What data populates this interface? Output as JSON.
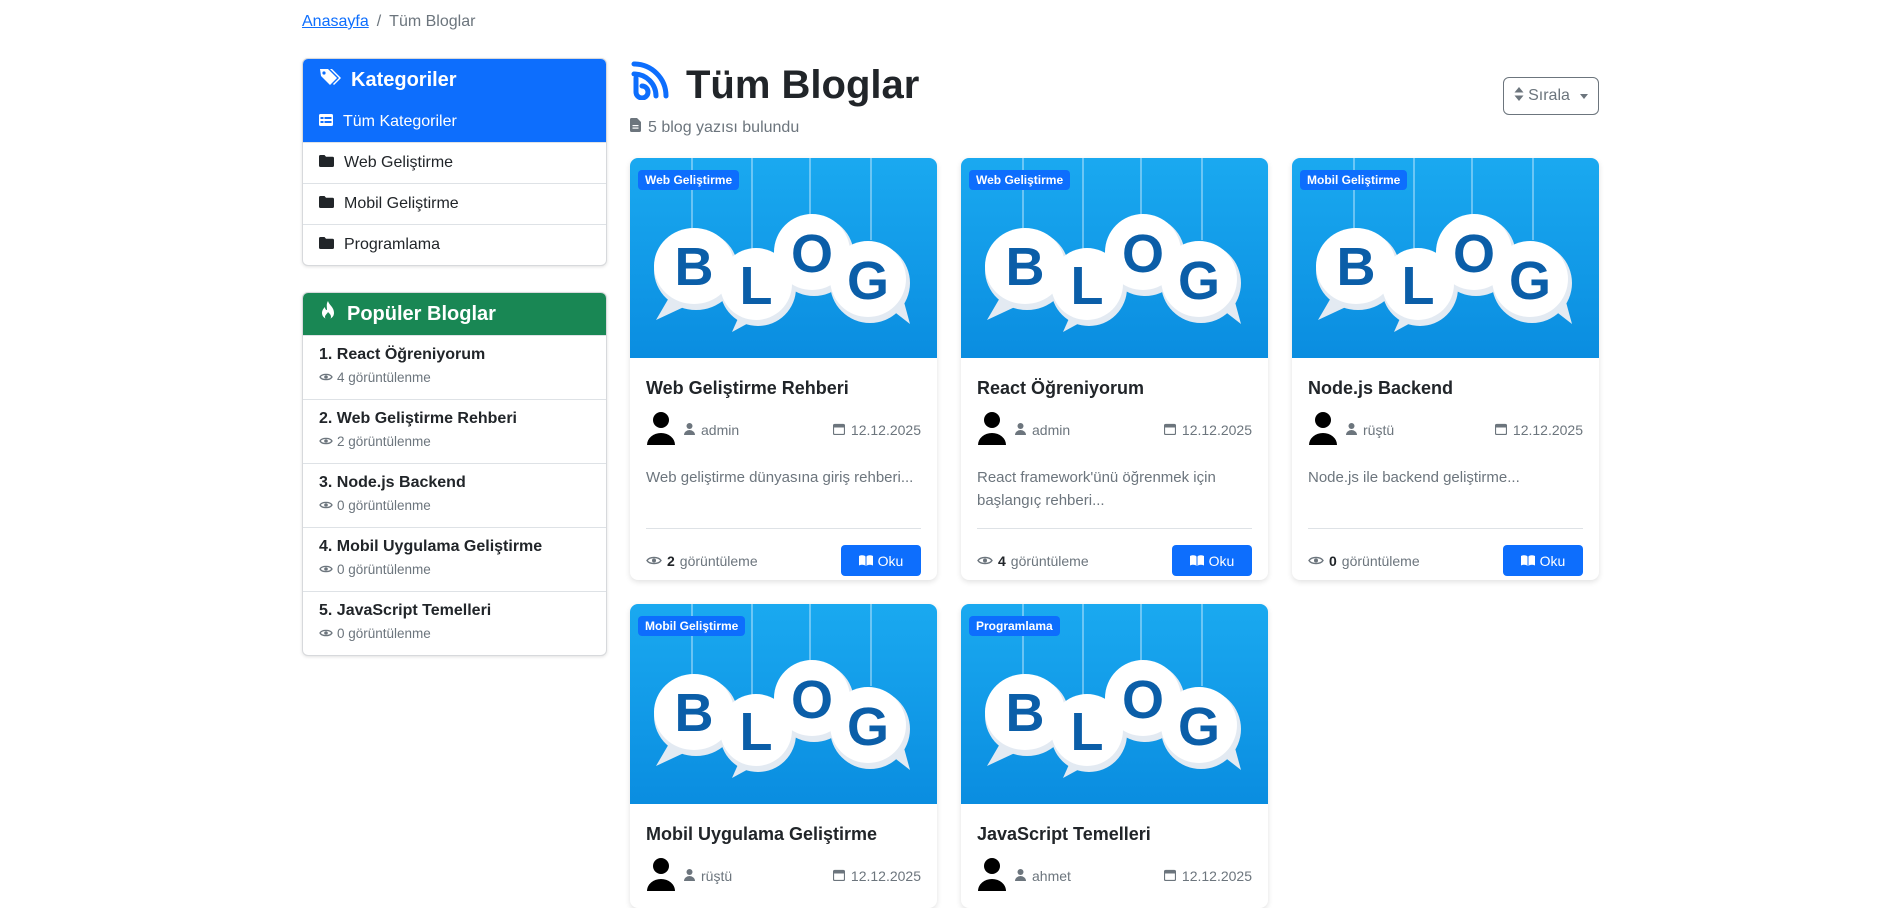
{
  "breadcrumb": {
    "home": "Anasayfa",
    "sep": "/",
    "current": "Tüm Bloglar"
  },
  "sidebar": {
    "categories_title": "Kategoriler",
    "categories": [
      {
        "label": "Tüm Kategoriler",
        "active": true
      },
      {
        "label": "Web Geliştirme"
      },
      {
        "label": "Mobil Geliştirme"
      },
      {
        "label": "Programlama"
      }
    ],
    "popular_title": "Popüler Bloglar",
    "popular": [
      {
        "title": "1. React Öğreniyorum",
        "views": "4 görüntülenme"
      },
      {
        "title": "2. Web Geliştirme Rehberi",
        "views": "2 görüntülenme"
      },
      {
        "title": "3. Node.js Backend",
        "views": "0 görüntülenme"
      },
      {
        "title": "4. Mobil Uygulama Geliştirme",
        "views": "0 görüntülenme"
      },
      {
        "title": "5. JavaScript Temelleri",
        "views": "0 görüntülenme"
      }
    ]
  },
  "header": {
    "title": "Tüm Bloglar",
    "subtitle": "5 blog yazısı bulundu",
    "sort_label": "Sırala"
  },
  "image_text": {
    "b": "B",
    "l": "L",
    "o": "O",
    "g": "G"
  },
  "posts": [
    {
      "badge": "Web Geliştirme",
      "title": "Web Geliştirme Rehberi",
      "author": "admin",
      "date": "12.12.2025",
      "excerpt": "Web geliştirme dünyasına giriş rehberi...",
      "views_count": "2",
      "views_label": "görüntüleme",
      "read": "Oku"
    },
    {
      "badge": "Web Geliştirme",
      "title": "React Öğreniyorum",
      "author": "admin",
      "date": "12.12.2025",
      "excerpt": "React framework'ünü öğrenmek için başlangıç rehberi...",
      "views_count": "4",
      "views_label": "görüntüleme",
      "read": "Oku"
    },
    {
      "badge": "Mobil Geliştirme",
      "title": "Node.js Backend",
      "author": "rüştü",
      "date": "12.12.2025",
      "excerpt": "Node.js ile backend geliştirme...",
      "views_count": "0",
      "views_label": "görüntüleme",
      "read": "Oku"
    },
    {
      "badge": "Mobil Geliştirme",
      "title": "Mobil Uygulama Geliştirme",
      "author": "rüştü",
      "date": "12.12.2025"
    },
    {
      "badge": "Programlama",
      "title": "JavaScript Temelleri",
      "author": "ahmet",
      "date": "12.12.2025"
    }
  ]
}
